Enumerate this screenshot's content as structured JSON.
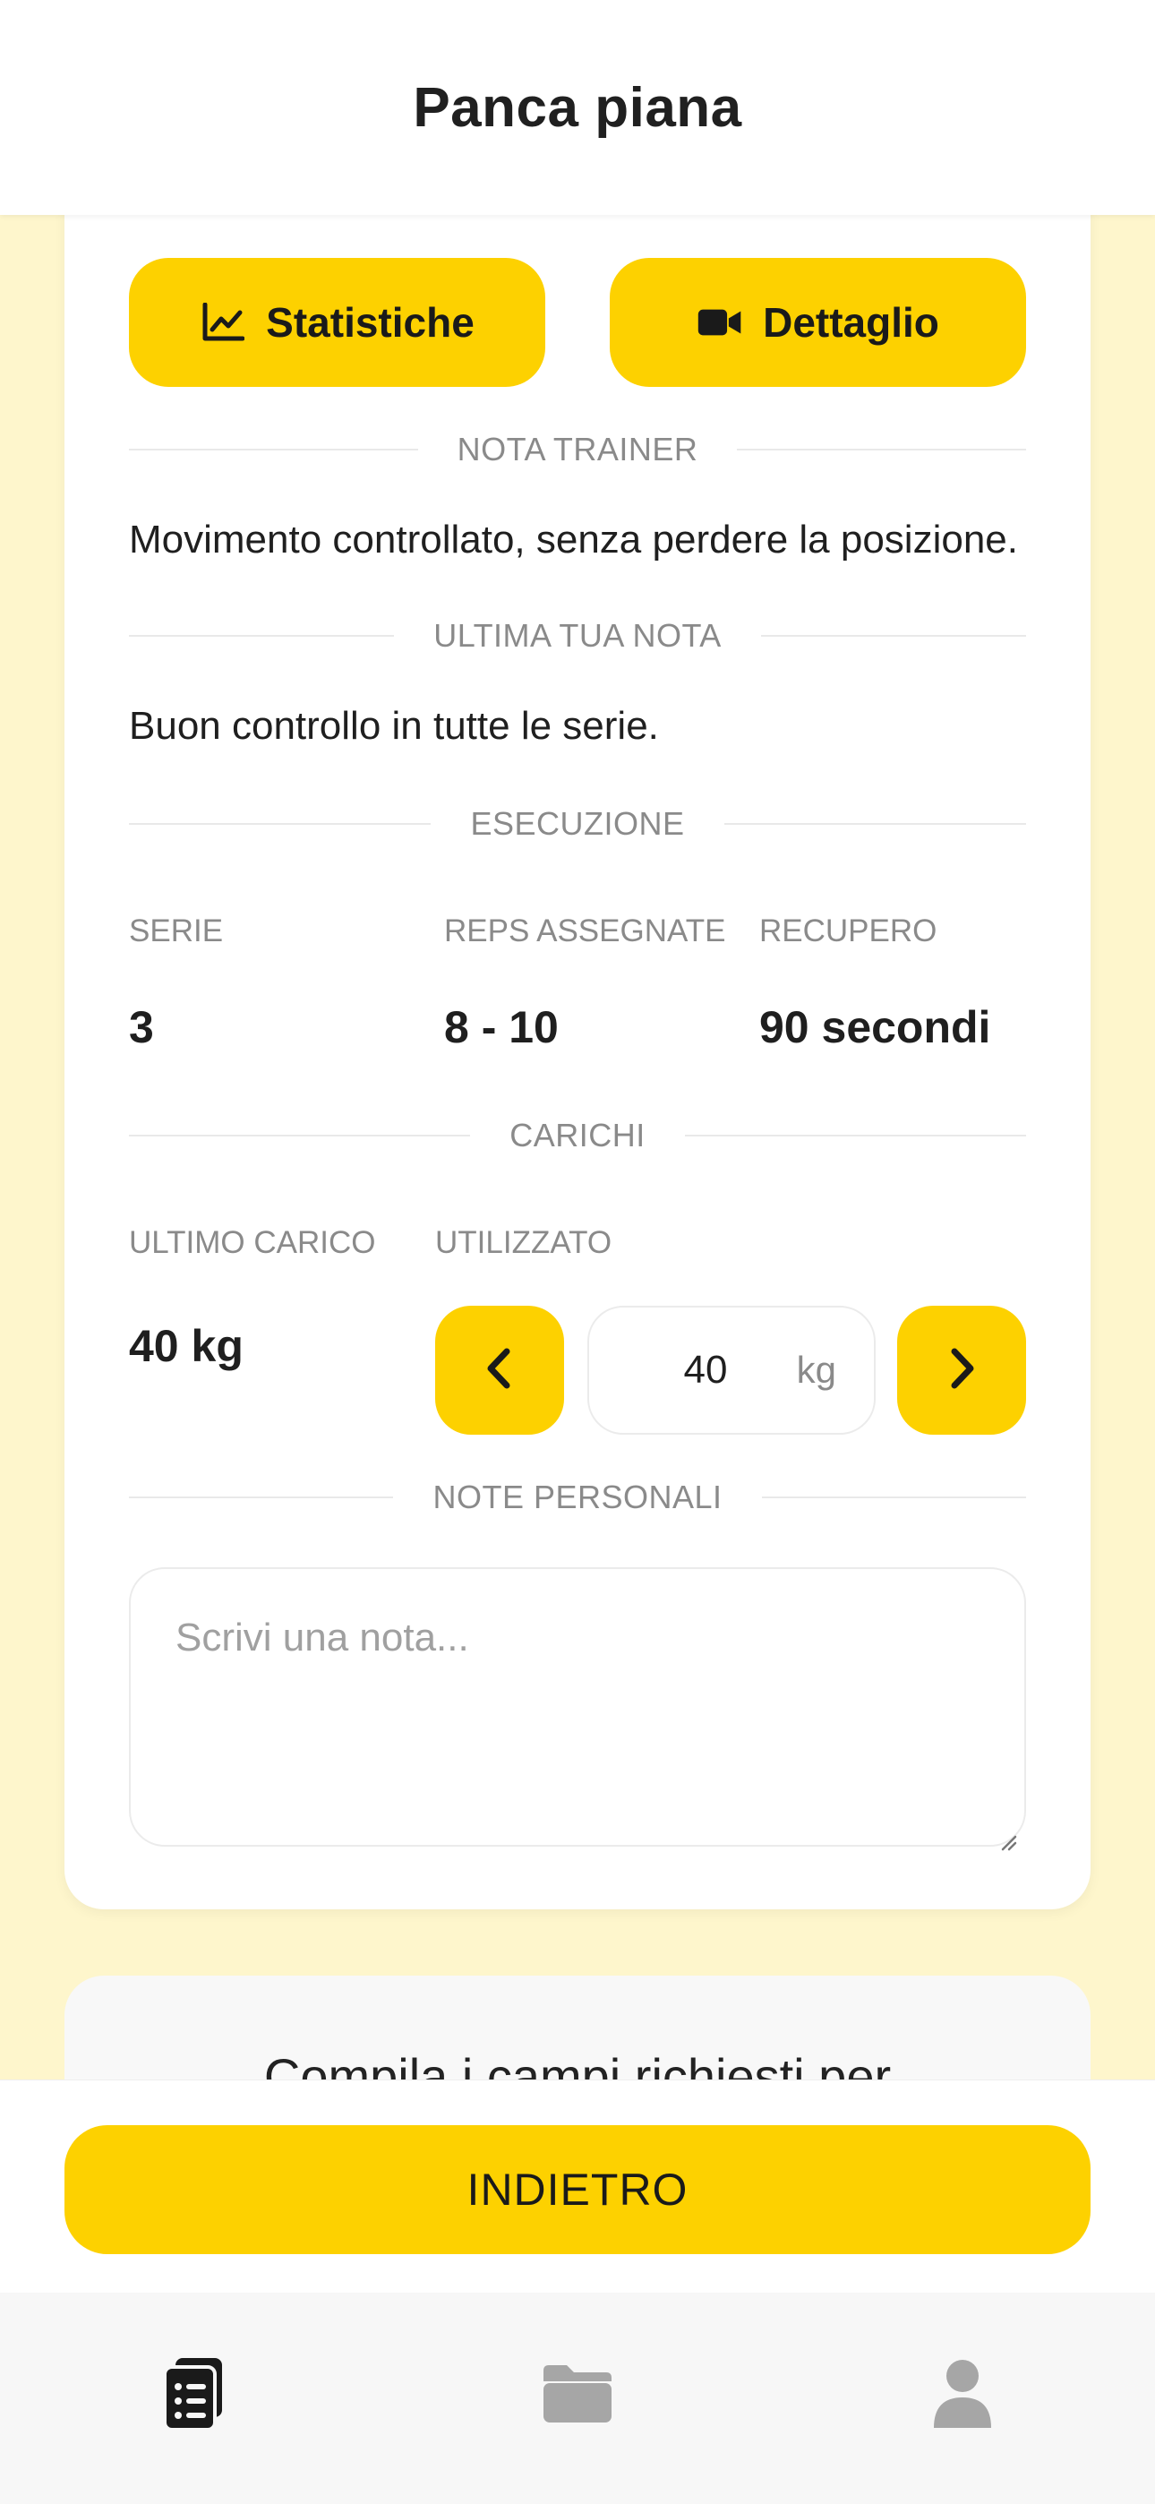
{
  "header": {
    "title": "Panca piana"
  },
  "actions": {
    "stats_label": "Statistiche",
    "detail_label": "Dettaglio"
  },
  "sections": {
    "trainer_note_title": "NOTA TRAINER",
    "trainer_note_text": "Movimento controllato, senza perdere la posizione.",
    "last_note_title": "ULTIMA TUA NOTA",
    "last_note_text": "Buon controllo in tutte le serie.",
    "execution_title": "ESECUZIONE",
    "loads_title": "CARICHI",
    "personal_notes_title": "NOTE PERSONALI"
  },
  "execution": {
    "sets_label": "SERIE",
    "sets_value": "3",
    "reps_label": "REPS ASSEGNATE",
    "reps_value": "8 - 10",
    "rest_label": "RECUPERO",
    "rest_value": "90 secondi"
  },
  "loads": {
    "last_label": "ULTIMO CARICO",
    "last_value": "40 kg",
    "used_label": "UTILIZZATO",
    "used_value": "40",
    "used_unit": "kg"
  },
  "notes": {
    "placeholder": "Scrivi una nota..."
  },
  "info_card": {
    "text": "Compila i campi richiesti per"
  },
  "bottom": {
    "back_label": "INDIETRO"
  },
  "tabs": [
    {
      "icon": "clipboard-list-icon",
      "active": true
    },
    {
      "icon": "folder-icon",
      "active": false
    },
    {
      "icon": "user-icon",
      "active": false
    }
  ],
  "colors": {
    "accent": "#FDD100",
    "background": "#FEF6CC",
    "muted": "#8a8a8a"
  }
}
